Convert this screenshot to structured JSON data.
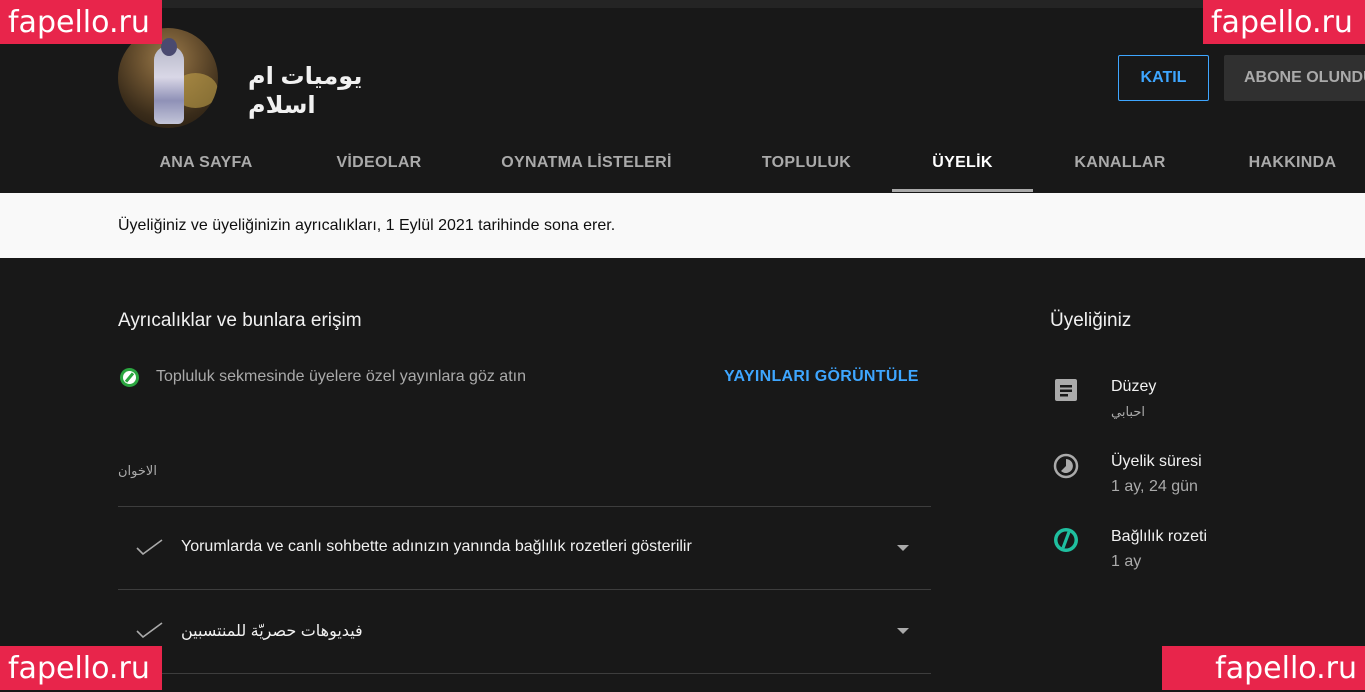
{
  "header": {
    "channel_name": "يوميات ام اسلام",
    "join_label": "KATIL",
    "subscribed_label": "ABONE OLUNDU"
  },
  "tabs": [
    {
      "label": "ANA SAYFA"
    },
    {
      "label": "VİDEOLAR"
    },
    {
      "label": "OYNATMA LİSTELERİ"
    },
    {
      "label": "TOPLULUK"
    },
    {
      "label": "ÜYELİK"
    },
    {
      "label": "KANALLAR"
    },
    {
      "label": "HAKKINDA"
    }
  ],
  "active_tab": "ÜYELİK",
  "notice": "Üyeliğiniz ve üyeliğinizin ayrıcalıkları, 1 Eylül 2021 tarihinde sona erer.",
  "perks": {
    "title": "Ayrıcalıklar ve bunlara erişim",
    "community_text": "Topluluk sekmesinde üyelere özel yayınlara göz atın",
    "view_posts_label": "YAYINLARI GÖRÜNTÜLE",
    "tier_label": "الاخوان",
    "items": [
      {
        "text": "Yorumlarda ve canlı sohbette adınızın yanında bağlılık rozetleri gösterilir"
      },
      {
        "text": "فيديوهات حصريّة للمنتسبين"
      }
    ]
  },
  "membership": {
    "title": "Üyeliğiniz",
    "level_label": "Düzey",
    "level_value": "احبابي",
    "duration_label": "Üyelik süresi",
    "duration_value": "1 ay, 24 gün",
    "badge_label": "Bağlılık rozeti",
    "badge_value": "1 ay"
  },
  "watermarks": {
    "text": "fapello.ru"
  },
  "colors": {
    "background": "#181818",
    "accent": "#3ea6ff",
    "badge_green": "#2ba640",
    "badge_teal": "#1fbf9f",
    "watermark": "#e8254b"
  }
}
